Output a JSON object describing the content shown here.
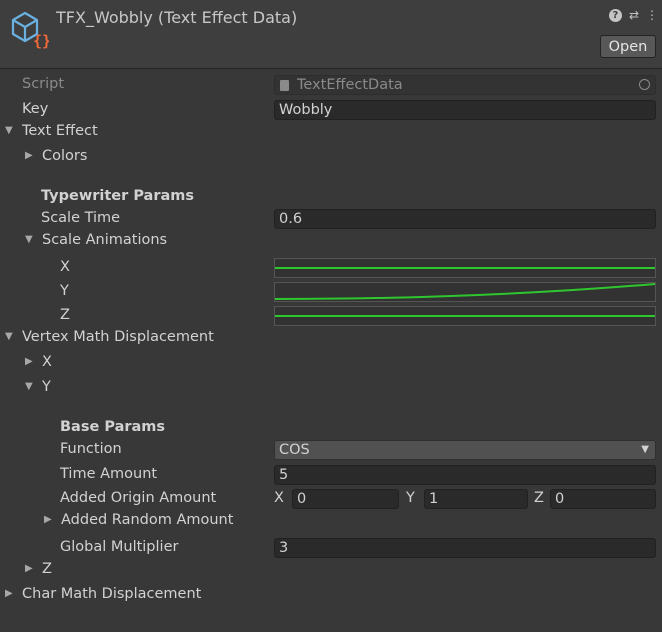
{
  "header": {
    "title": "TFX_Wobbly (Text Effect Data)",
    "open_label": "Open",
    "icons": [
      "help-icon",
      "settings-icon",
      "more-icon"
    ]
  },
  "fields": {
    "script": {
      "label": "Script",
      "value": "TextEffectData"
    },
    "key": {
      "label": "Key",
      "value": "Wobbly"
    },
    "text_effect": {
      "label": "Text Effect"
    },
    "colors": {
      "label": "Colors"
    },
    "typewriter_params": {
      "label": "Typewriter Params"
    },
    "scale_time": {
      "label": "Scale Time",
      "value": "0.6"
    },
    "scale_animations": {
      "label": "Scale Animations"
    },
    "curve_x": {
      "label": "X"
    },
    "curve_y": {
      "label": "Y"
    },
    "curve_z": {
      "label": "Z"
    },
    "vertex_math": {
      "label": "Vertex Math Displacement"
    },
    "vm_x": {
      "label": "X"
    },
    "vm_y": {
      "label": "Y"
    },
    "base_params": {
      "label": "Base Params"
    },
    "function": {
      "label": "Function",
      "value": "COS"
    },
    "time_amount": {
      "label": "Time Amount",
      "value": "5"
    },
    "added_origin": {
      "label": "Added Origin Amount",
      "x_label": "X",
      "x": "0",
      "y_label": "Y",
      "y": "1",
      "z_label": "Z",
      "z": "0"
    },
    "added_random": {
      "label": "Added Random Amount"
    },
    "global_multiplier": {
      "label": "Global Multiplier",
      "value": "3"
    },
    "vm_z": {
      "label": "Z"
    },
    "char_math": {
      "label": "Char Math Displacement"
    }
  },
  "colors": {
    "background": "#383838",
    "field_bg": "#2a2a2a",
    "curve_line": "#2fc62f",
    "icon_blue": "#6ab0e0",
    "icon_orange": "#ef6b3a"
  }
}
